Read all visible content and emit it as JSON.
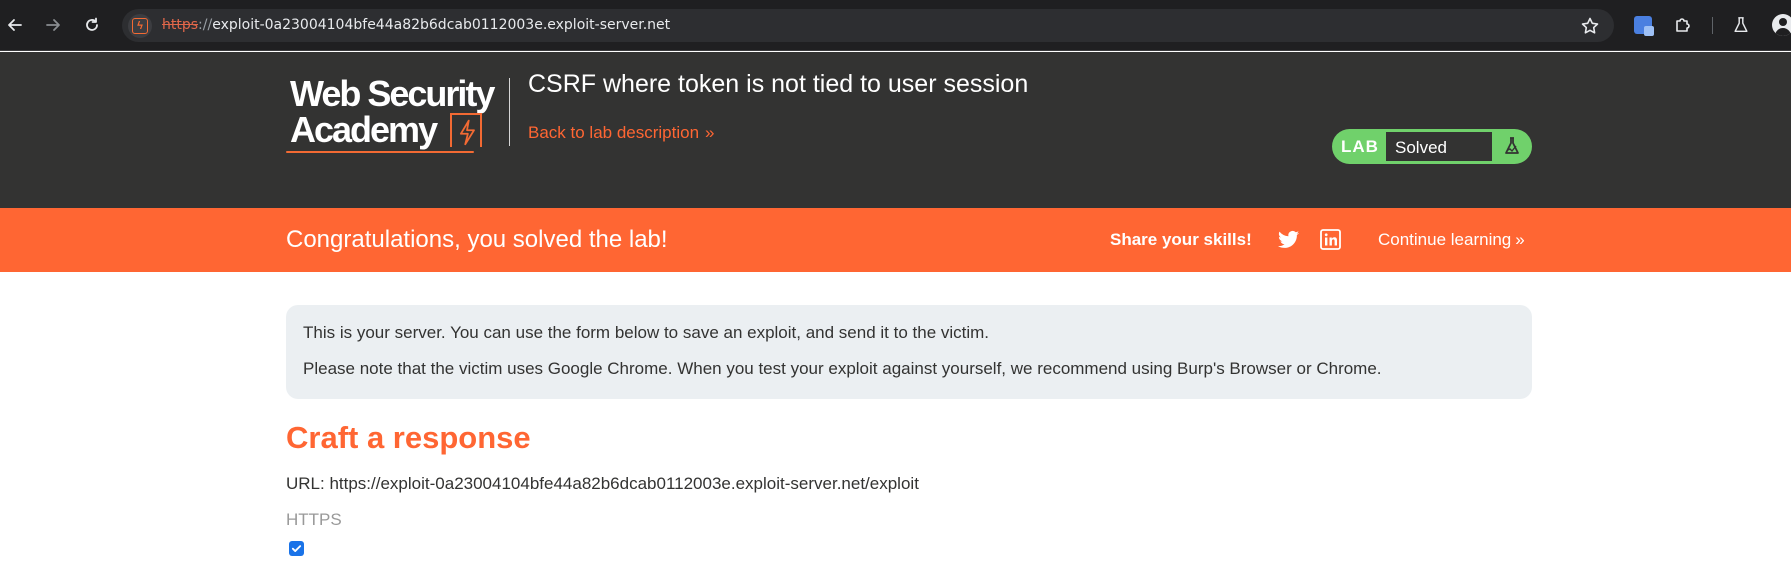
{
  "browser": {
    "url_scheme": "https",
    "url_separator": "://",
    "url_host": "exploit-0a23004104bfe44a82b6dcab0112003e.exploit-server.net",
    "icons": [
      "back-icon",
      "forward-icon",
      "reload-icon",
      "site-info-icon",
      "bookmark-star-icon",
      "translate-icon",
      "extensions-icon",
      "labs-flask-icon",
      "profile-icon"
    ]
  },
  "header": {
    "logo_line1": "Web Security",
    "logo_line2": "Academy",
    "lab_title": "CSRF where token is not tied to user session",
    "back_link": "Back to lab description",
    "back_link_chevron": "»",
    "status_label": "LAB",
    "status_value": "Solved"
  },
  "banner": {
    "message": "Congratulations, you solved the lab!",
    "share_label": "Share your skills!",
    "continue_label": "Continue learning",
    "continue_chevron": "»"
  },
  "notice": {
    "line1": "This is your server. You can use the form below to save an exploit, and send it to the victim.",
    "line2": "Please note that the victim uses Google Chrome. When you test your exploit against yourself, we recommend using Burp's Browser or Chrome."
  },
  "form": {
    "title": "Craft a response",
    "url_line": "URL: https://exploit-0a23004104bfe44a82b6dcab0112003e.exploit-server.net/exploit",
    "https_label": "HTTPS",
    "https_checked": true
  },
  "colors": {
    "accent_orange": "#ff6633",
    "header_dark": "#333332",
    "solved_green": "#70d16b",
    "notice_bg": "#ebeff2"
  }
}
